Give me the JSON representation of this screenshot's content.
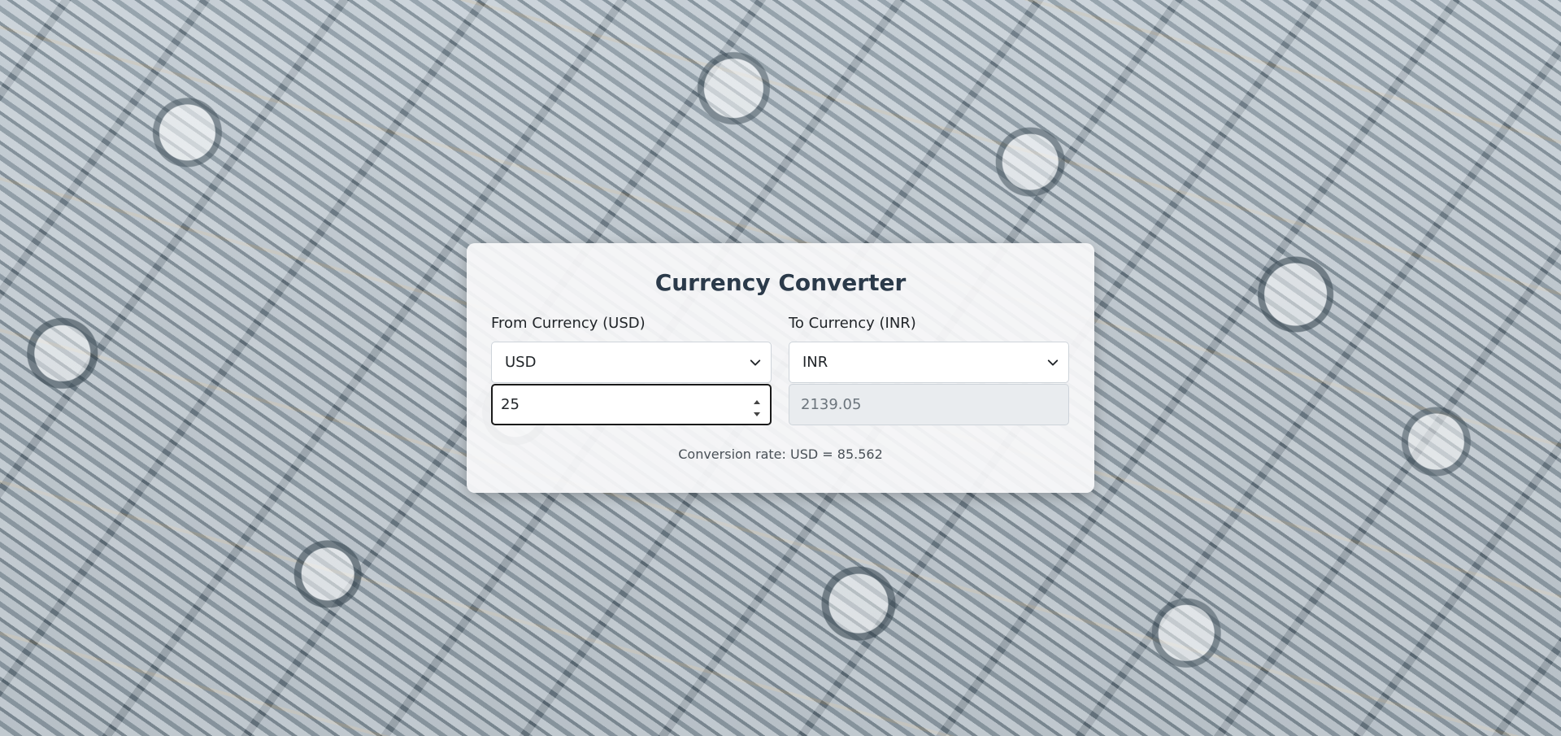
{
  "background": {
    "description_icon": "money-rolls-background"
  },
  "converter": {
    "title": "Currency Converter",
    "from": {
      "label": "From Currency (USD)",
      "selected": "USD",
      "amount": "25"
    },
    "to": {
      "label": "To Currency (INR)",
      "selected": "INR",
      "amount": "2139.05"
    },
    "rate_text": "Conversion rate: USD = 85.562"
  },
  "colors": {
    "title": "#2b3a4a",
    "card": "#f8f9fa",
    "readonly_bg": "#e9ecef",
    "active_border": "#1a1a1a"
  }
}
